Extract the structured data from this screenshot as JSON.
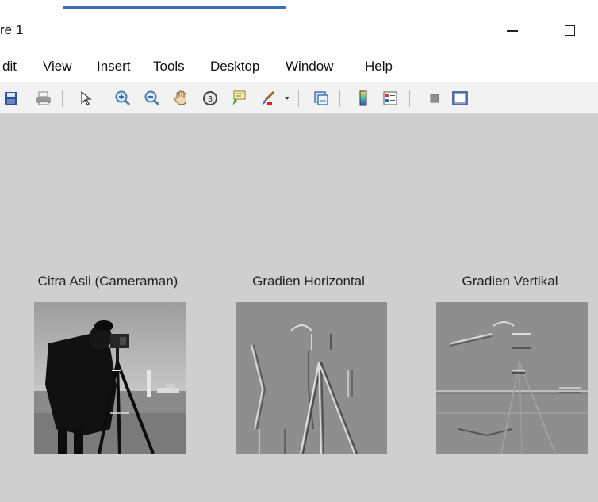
{
  "window": {
    "title": "re 1"
  },
  "menu": {
    "items": [
      "dit",
      "View",
      "Insert",
      "Tools",
      "Desktop",
      "Window",
      "Help"
    ]
  },
  "toolbar": {
    "icons": [
      "save-icon",
      "print-icon",
      "pointer-icon",
      "zoom-in-icon",
      "zoom-out-icon",
      "pan-hand-icon",
      "rotate-3d-icon",
      "data-cursor-icon",
      "brush-icon",
      "dropdown-arrow-icon",
      "link-plot-icon",
      "colorbar-icon",
      "legend-icon",
      "hide-plot-tools-icon",
      "show-plot-tools-icon"
    ]
  },
  "axes": [
    {
      "title": "Citra Asli (Cameraman)"
    },
    {
      "title": "Gradien Horizontal"
    },
    {
      "title": "Gradien Vertikal"
    }
  ],
  "colors": {
    "figure_bg": "#cfcfcf",
    "window_bg": "#ffffff",
    "toolbar_bg": "#f2f2f2",
    "accent": "#3b6fb6",
    "gradient_bg": "#8e8e8e"
  }
}
